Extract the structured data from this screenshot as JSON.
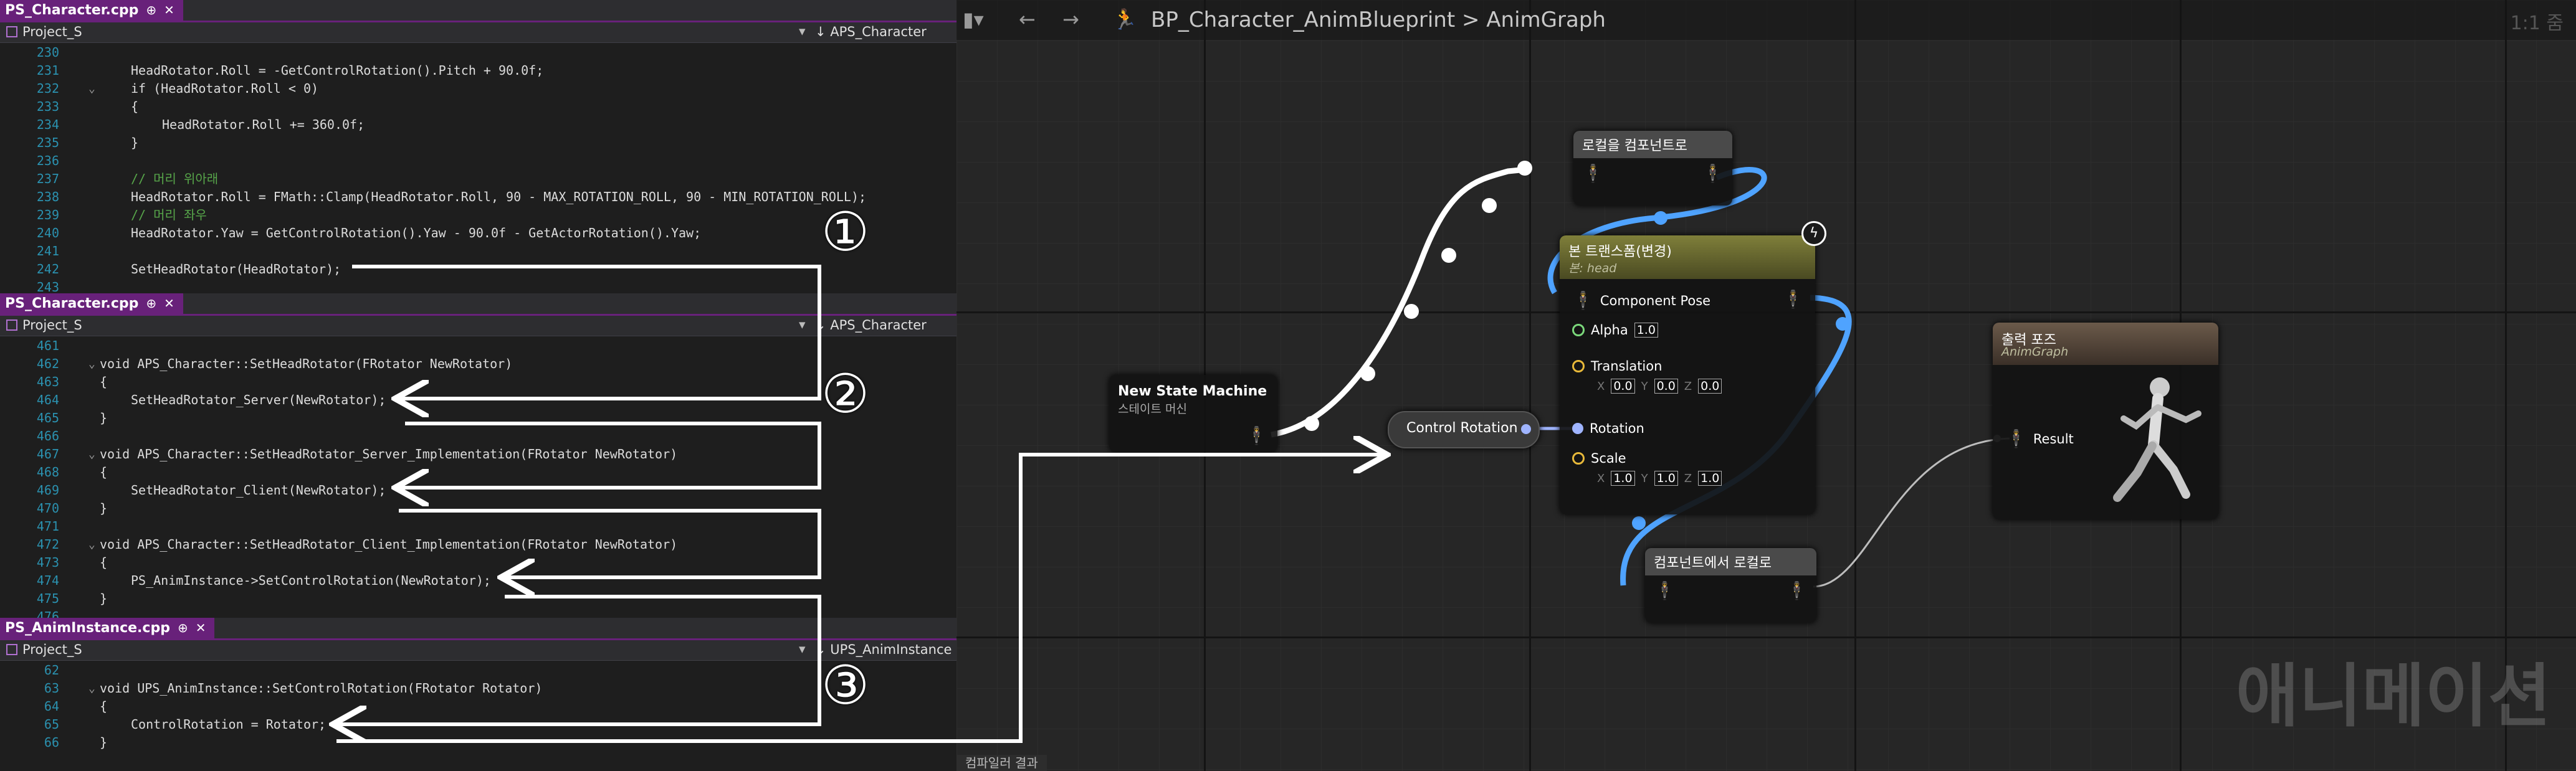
{
  "panes": [
    {
      "file_tab": "PS_Character.cpp",
      "project": "Project_S",
      "class_scope": "APS_Character",
      "lines": [
        {
          "n": "230",
          "text": "",
          "indent": 1
        },
        {
          "n": "231",
          "text": "HeadRotator.Roll = -GetControlRotation().Pitch + 90.0f;",
          "indent": 1
        },
        {
          "n": "232",
          "text": "if (HeadRotator.Roll < 0)",
          "indent": 1,
          "fold": "v"
        },
        {
          "n": "233",
          "text": "{",
          "indent": 1
        },
        {
          "n": "234",
          "text": "HeadRotator.Roll += 360.0f;",
          "indent": 2
        },
        {
          "n": "235",
          "text": "}",
          "indent": 1
        },
        {
          "n": "236",
          "text": "",
          "indent": 1
        },
        {
          "n": "237",
          "text": "// 머리 위아래",
          "indent": 1,
          "comment": true
        },
        {
          "n": "238",
          "text": "HeadRotator.Roll = FMath::Clamp(HeadRotator.Roll, 90 - MAX_ROTATION_ROLL, 90 - MIN_ROTATION_ROLL);",
          "indent": 1
        },
        {
          "n": "239",
          "text": "// 머리 좌우",
          "indent": 1,
          "comment": true
        },
        {
          "n": "240",
          "text": "HeadRotator.Yaw = GetControlRotation().Yaw - 90.0f - GetActorRotation().Yaw;",
          "indent": 1
        },
        {
          "n": "241",
          "text": "",
          "indent": 1
        },
        {
          "n": "242",
          "text": "SetHeadRotator(HeadRotator);",
          "indent": 1
        },
        {
          "n": "243",
          "text": "",
          "indent": 1
        }
      ]
    },
    {
      "file_tab": "PS_Character.cpp",
      "project": "Project_S",
      "class_scope": "APS_Character",
      "lines": [
        {
          "n": "461",
          "text": "",
          "indent": 0
        },
        {
          "n": "462",
          "text": "void APS_Character::SetHeadRotator(FRotator NewRotator)",
          "indent": 0,
          "fold": "v"
        },
        {
          "n": "463",
          "text": "{",
          "indent": 0
        },
        {
          "n": "464",
          "text": "SetHeadRotator_Server(NewRotator);",
          "indent": 1
        },
        {
          "n": "465",
          "text": "}",
          "indent": 0
        },
        {
          "n": "466",
          "text": "",
          "indent": 0
        },
        {
          "n": "467",
          "text": "void APS_Character::SetHeadRotator_Server_Implementation(FRotator NewRotator)",
          "indent": 0,
          "fold": "v"
        },
        {
          "n": "468",
          "text": "{",
          "indent": 0
        },
        {
          "n": "469",
          "text": "SetHeadRotator_Client(NewRotator);",
          "indent": 1
        },
        {
          "n": "470",
          "text": "}",
          "indent": 0
        },
        {
          "n": "471",
          "text": "",
          "indent": 0
        },
        {
          "n": "472",
          "text": "void APS_Character::SetHeadRotator_Client_Implementation(FRotator NewRotator)",
          "indent": 0,
          "fold": "v"
        },
        {
          "n": "473",
          "text": "{",
          "indent": 0
        },
        {
          "n": "474",
          "text": "PS_AnimInstance->SetControlRotation(NewRotator);",
          "indent": 1
        },
        {
          "n": "475",
          "text": "}",
          "indent": 0
        },
        {
          "n": "476",
          "text": "",
          "indent": 0
        }
      ]
    },
    {
      "file_tab": "PS_AnimInstance.cpp",
      "project": "Project_S",
      "class_scope": "UPS_AnimInstance",
      "lines": [
        {
          "n": "62",
          "text": "",
          "indent": 0
        },
        {
          "n": "63",
          "text": "void UPS_AnimInstance::SetControlRotation(FRotator Rotator)",
          "indent": 0,
          "fold": "v"
        },
        {
          "n": "64",
          "text": "{",
          "indent": 0
        },
        {
          "n": "65",
          "text": "ControlRotation = Rotator;",
          "indent": 1
        },
        {
          "n": "66",
          "text": "}",
          "indent": 0
        }
      ]
    }
  ],
  "badges": [
    "①",
    "②",
    "③"
  ],
  "graph": {
    "breadcrumb": "BP_Character_AnimBlueprint > AnimGraph",
    "zoom": "1:1 줌",
    "watermark": "애니메이션",
    "bottom_tab": "컴파일러 결과",
    "nodes": {
      "state_machine": {
        "title": "New State Machine",
        "subtitle": "스테이트 머신"
      },
      "control_rotation": {
        "title": "Control Rotation"
      },
      "local_to_component": {
        "title": "로컬을 컴포넌트로"
      },
      "transform_bone": {
        "title": "본 트랜스폼(변경)",
        "subtitle": "본: head",
        "pin_component_pose": "Component Pose",
        "pin_alpha": "Alpha",
        "alpha_value": "1.0",
        "pin_translation": "Translation",
        "translation": [
          "0.0",
          "0.0",
          "0.0"
        ],
        "pin_rotation": "Rotation",
        "pin_scale": "Scale",
        "scale": [
          "1.0",
          "1.0",
          "1.0"
        ],
        "axes": [
          "X",
          "Y",
          "Z"
        ]
      },
      "component_to_local": {
        "title": "컴포넌트에서 로컬로"
      },
      "output_pose": {
        "title": "출력 포즈",
        "subtitle": "AnimGraph",
        "pin_result": "Result"
      }
    }
  },
  "colors": {
    "accent": "#68217a",
    "line_numbers": "#2b91af",
    "comment": "#57a64a",
    "pose_wire": "#4fa3ff",
    "rotator_pin": "#9fb4ff"
  }
}
